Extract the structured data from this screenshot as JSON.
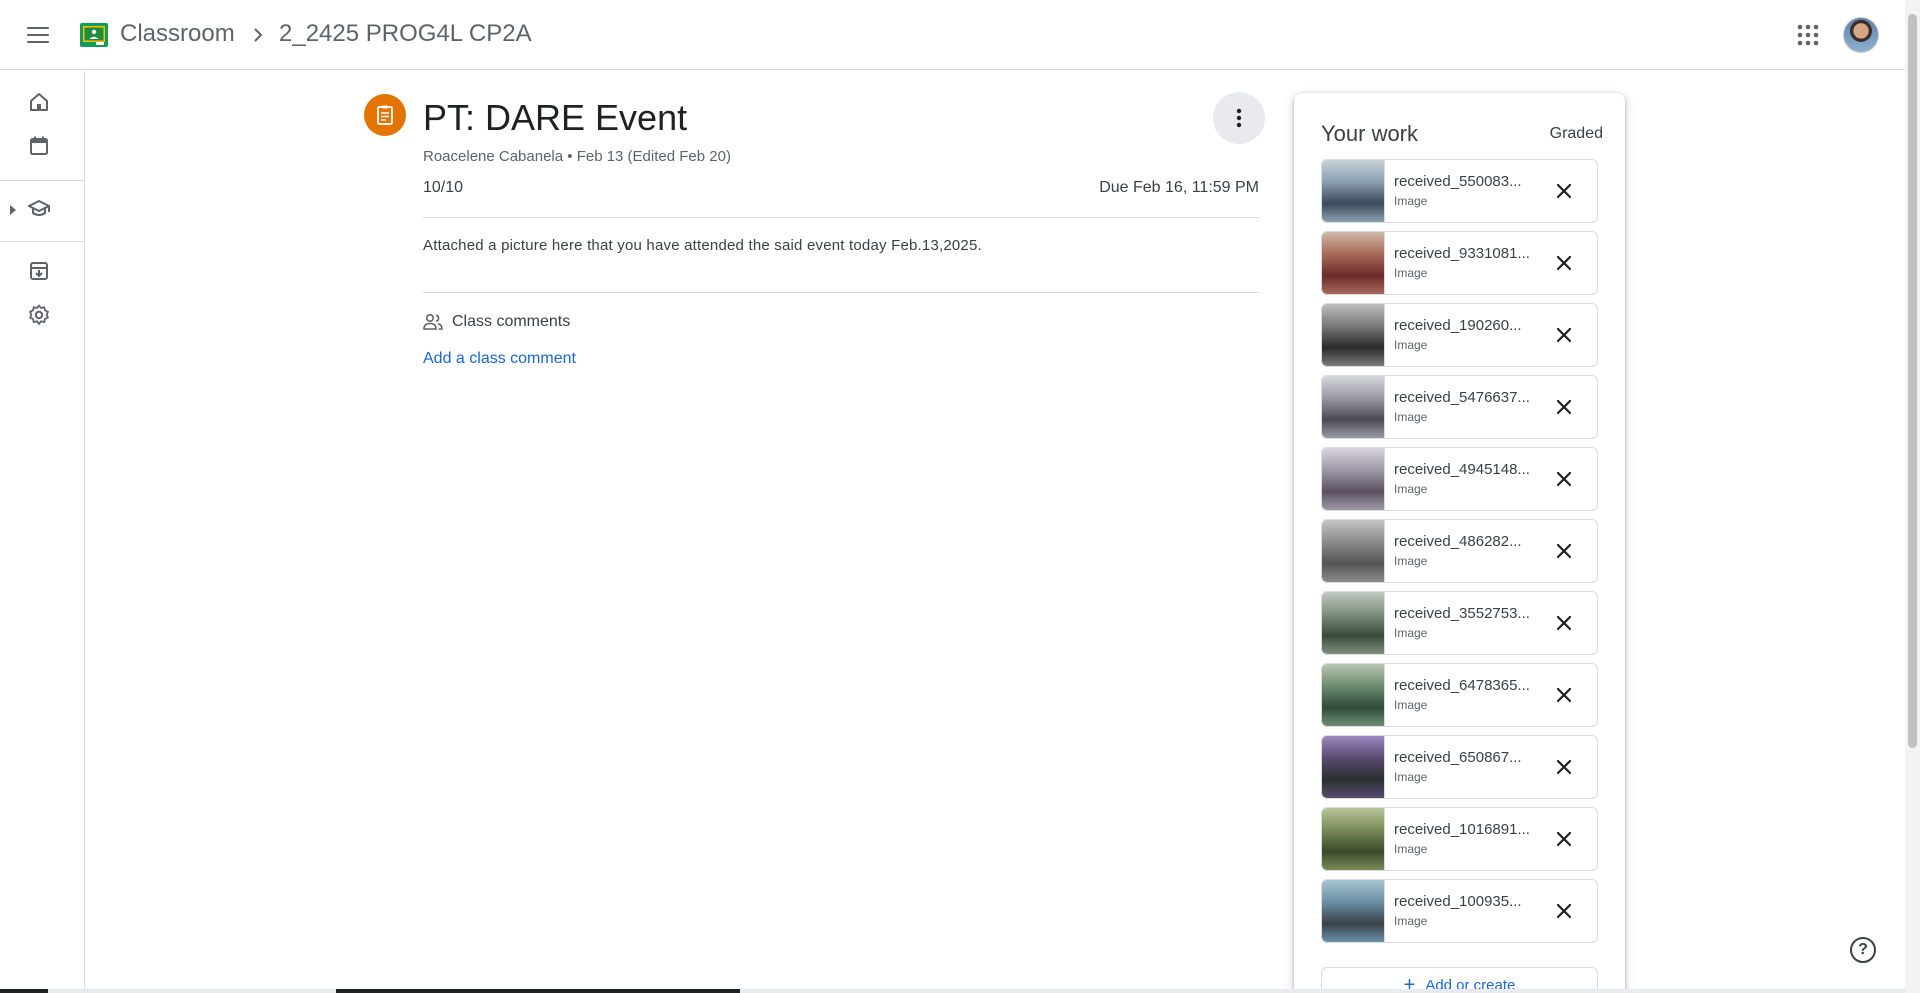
{
  "header": {
    "app_title": "Classroom",
    "course_title": "2_2425 PROG4L CP2A",
    "icons": [
      "main-menu-icon",
      "classroom-logo",
      "chevron-right-icon",
      "google-apps-icon",
      "account-avatar"
    ]
  },
  "rail": {
    "items": [
      {
        "name": "home-icon"
      },
      {
        "name": "calendar-icon"
      },
      {
        "name": "enrolled-icon"
      },
      {
        "name": "archived-classes-icon"
      },
      {
        "name": "settings-icon"
      }
    ]
  },
  "assignment": {
    "title": "PT: DARE Event",
    "meta": "Roacelene Cabanela • Feb 13 (Edited Feb 20)",
    "points": "10/10",
    "due": "Due Feb 16, 11:59 PM",
    "instructions": "Attached a picture here that you have attended the said event today Feb.13,2025.",
    "icon_color": "#e37400"
  },
  "comments": {
    "title": "Class comments",
    "add_label": "Add a class comment",
    "link_color": "#1967d2"
  },
  "work": {
    "title": "Your work",
    "status": "Graded",
    "attachments": [
      {
        "name": "received_550083...",
        "type": "Image"
      },
      {
        "name": "received_9331081...",
        "type": "Image"
      },
      {
        "name": "received_190260...",
        "type": "Image"
      },
      {
        "name": "received_5476637...",
        "type": "Image"
      },
      {
        "name": "received_4945148...",
        "type": "Image"
      },
      {
        "name": "received_486282...",
        "type": "Image"
      },
      {
        "name": "received_3552753...",
        "type": "Image"
      },
      {
        "name": "received_6478365...",
        "type": "Image"
      },
      {
        "name": "received_650867...",
        "type": "Image"
      },
      {
        "name": "received_1016891...",
        "type": "Image"
      },
      {
        "name": "received_100935...",
        "type": "Image"
      }
    ],
    "add_label": "Add or create"
  },
  "help": {
    "label": "?"
  }
}
